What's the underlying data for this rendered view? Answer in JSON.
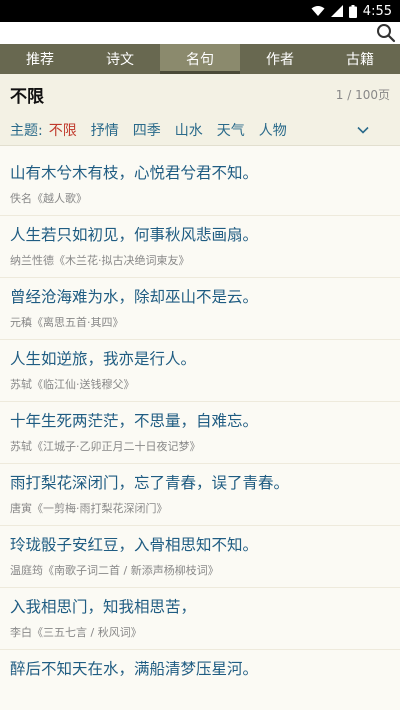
{
  "status_bar": {
    "time": "4:55",
    "icons": [
      "wifi-icon",
      "signal-icon",
      "battery-icon"
    ]
  },
  "search": {
    "placeholder": "",
    "icon": "search-icon"
  },
  "tabs": [
    {
      "label": "推荐",
      "active": false
    },
    {
      "label": "诗文",
      "active": false
    },
    {
      "label": "名句",
      "active": true
    },
    {
      "label": "作者",
      "active": false
    },
    {
      "label": "古籍",
      "active": false
    }
  ],
  "header": {
    "title": "不限",
    "page_indicator": "1 / 100页"
  },
  "filter": {
    "label": "主题:",
    "options": [
      {
        "label": "不限",
        "active": true
      },
      {
        "label": "抒情",
        "active": false
      },
      {
        "label": "四季",
        "active": false
      },
      {
        "label": "山水",
        "active": false
      },
      {
        "label": "天气",
        "active": false
      },
      {
        "label": "人物",
        "active": false
      }
    ],
    "expand_icon": "chevron-down-icon"
  },
  "colors": {
    "tab_bar": "#686850",
    "tab_active": "#8b8a6d",
    "quote_text": "#1f5c82",
    "active_filter": "#c0392b",
    "filter_text": "#2a6a8a"
  },
  "quotes": [
    {
      "text": "山有木兮木有枝，心悦君兮君不知。",
      "source": "佚名《越人歌》"
    },
    {
      "text": "人生若只如初见，何事秋风悲画扇。",
      "source": "纳兰性德《木兰花·拟古决绝词柬友》"
    },
    {
      "text": "曾经沧海难为水，除却巫山不是云。",
      "source": "元稹《离思五首·其四》"
    },
    {
      "text": "人生如逆旅，我亦是行人。",
      "source": "苏轼《临江仙·送钱穆父》"
    },
    {
      "text": "十年生死两茫茫，不思量，自难忘。",
      "source": "苏轼《江城子·乙卯正月二十日夜记梦》"
    },
    {
      "text": "雨打梨花深闭门，忘了青春，误了青春。",
      "source": "唐寅《一剪梅·雨打梨花深闭门》"
    },
    {
      "text": "玲珑骰子安红豆，入骨相思知不知。",
      "source": "温庭筠《南歌子词二首 / 新添声杨柳枝词》"
    },
    {
      "text": "入我相思门，知我相思苦，",
      "source": "李白《三五七言 / 秋风词》"
    },
    {
      "text": "醉后不知天在水，满船清梦压星河。",
      "source": ""
    }
  ]
}
